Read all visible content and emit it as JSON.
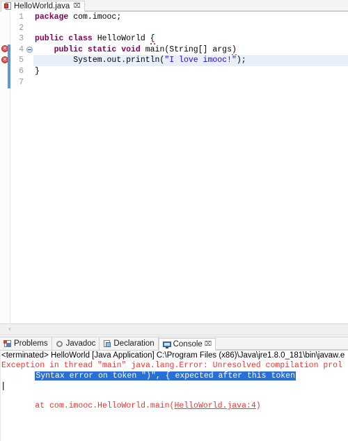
{
  "editor": {
    "tab": {
      "icon": "java-file-icon",
      "filename": "HelloWorld.java",
      "close": "⌧"
    },
    "gutter": {
      "error_marker_glyph": "✕",
      "fold_marker": "fold-collapse-icon"
    },
    "line_numbers": [
      "1",
      "2",
      "3",
      "4",
      "5",
      "6",
      "7"
    ],
    "lines": [
      {
        "num": "1",
        "tokens": [
          {
            "text": "package",
            "style": "kw"
          },
          {
            "text": " com.imooc;",
            "style": "plain"
          }
        ]
      },
      {
        "num": "2",
        "tokens": []
      },
      {
        "num": "3",
        "tokens": [
          {
            "text": "public class",
            "style": "kw"
          },
          {
            "text": " HelloWorld ",
            "style": "plain"
          },
          {
            "text": "{",
            "style": "squig"
          }
        ]
      },
      {
        "num": "4",
        "tokens": [
          {
            "text": "    ",
            "style": "plain"
          },
          {
            "text": "public static void",
            "style": "kw"
          },
          {
            "text": " main(String[] args",
            "style": "plain"
          },
          {
            "text": ")",
            "style": "squig"
          }
        ]
      },
      {
        "num": "5",
        "tokens": [
          {
            "text": "        System.out.println(",
            "style": "plain"
          },
          {
            "text": "\"I love imooc!\"",
            "style": "str"
          },
          {
            "text": ");",
            "style": "plain"
          }
        ]
      },
      {
        "num": "6",
        "tokens": [
          {
            "text": "}",
            "style": "plain"
          }
        ]
      },
      {
        "num": "7",
        "tokens": []
      }
    ],
    "scrollbar": {
      "left_arrow": "‹"
    }
  },
  "console_panel": {
    "tabs": [
      {
        "label": "Problems",
        "icon": "problems-icon",
        "active": false
      },
      {
        "label": "Javadoc",
        "icon": "javadoc-icon",
        "active": false
      },
      {
        "label": "Declaration",
        "icon": "declaration-icon",
        "active": false
      },
      {
        "label": "Console",
        "icon": "console-icon",
        "active": true,
        "close": "⌧"
      }
    ],
    "output": {
      "process_header": "<terminated> HelloWorld [Java Application] C:\\Program Files (x86)\\Java\\jre1.8.0_181\\bin\\javaw.e",
      "exception_line": "Exception in thread \"main\" java.lang.Error: Unresolved compilation prol",
      "selected_message_indent": "       ",
      "selected_message": "Syntax error on token \")\", { expected after this token",
      "stack_indent": "       at com.imooc.HelloWorld.main(",
      "stack_link": "HelloWorld.java:4",
      "stack_tail": ")"
    }
  },
  "colors": {
    "keyword": "#7f0055",
    "string": "#2a00ff",
    "error_text": "#f0352f",
    "selection": "#2a6fd6",
    "highlight_line": "#e8effb",
    "change_bar": "#5b9ad6"
  }
}
